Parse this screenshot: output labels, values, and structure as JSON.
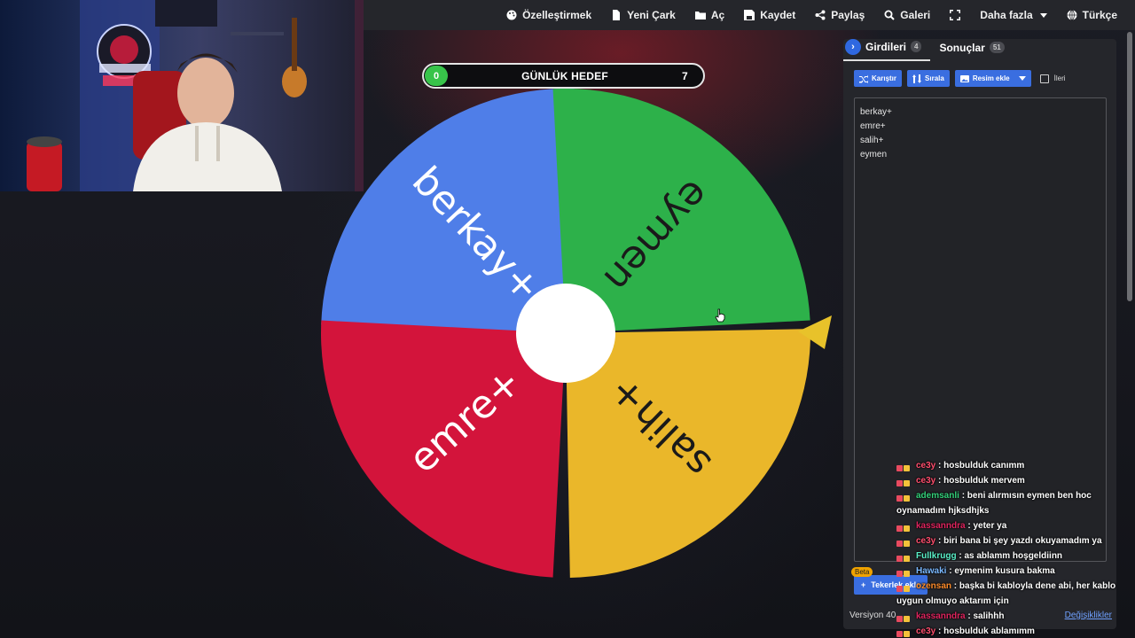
{
  "nav": {
    "items": [
      {
        "label": "Özelleştirmek",
        "icon": "palette-icon"
      },
      {
        "label": "Yeni Çark",
        "icon": "file-icon"
      },
      {
        "label": "Aç",
        "icon": "folder-icon"
      },
      {
        "label": "Kaydet",
        "icon": "save-icon"
      },
      {
        "label": "Paylaş",
        "icon": "share-icon"
      },
      {
        "label": "Galeri",
        "icon": "search-icon"
      },
      {
        "label": "",
        "icon": "fullscreen-icon"
      },
      {
        "label": "Daha fazla",
        "icon": "caret-down-icon"
      },
      {
        "label": "Türkçe",
        "icon": "globe-icon"
      }
    ]
  },
  "goal": {
    "title": "GÜNLÜK HEDEF",
    "current": "0",
    "target": "7",
    "progress": 0
  },
  "wheel": {
    "segments": [
      {
        "label": "berkay+",
        "color": "#4f7ee8"
      },
      {
        "label": "eymen",
        "color": "#2db14a"
      },
      {
        "label": "salih+",
        "color": "#eab72a"
      },
      {
        "label": "emre+",
        "color": "#d3143b"
      }
    ],
    "pointer_color": "#e8c22a"
  },
  "panel": {
    "tab_entries_label": "Girdileri",
    "tab_entries_count": "4",
    "tab_results_label": "Sonuçlar",
    "tab_results_count": "51",
    "shuffle_label": "Karıştır",
    "sort_label": "Sırala",
    "add_image_label": "Resim ekle",
    "advanced_label": "İleri",
    "entries": [
      "berkay+",
      "emre+",
      "salih+",
      "eymen"
    ],
    "beta_label": "Beta",
    "add_wheel_label": "Tekerlek ekle",
    "version_label": "Versiyon 40",
    "changes_label": "Değişiklikler"
  },
  "chat": [
    {
      "user": "ce3y",
      "user_color": "#ff4d6d",
      "message": " : hosbulduk canımm"
    },
    {
      "user": "ce3y",
      "user_color": "#ff4d6d",
      "message": " : hosbulduk mervem"
    },
    {
      "user": "ademsanli",
      "user_color": "#33d17a",
      "message": " : beni alırmısın eymen ben hoc oynamadım hjksdhjks"
    },
    {
      "user": "kassanndra",
      "user_color": "#e0245e",
      "message": " : yeter ya"
    },
    {
      "user": "ce3y",
      "user_color": "#ff4d6d",
      "message": " : biri bana bi şey yazdı okuyamadım ya"
    },
    {
      "user": "Fullkrugg",
      "user_color": "#5af0c8",
      "message": " : as ablamm hoşgeldiinn"
    },
    {
      "user": "Hawaki",
      "user_color": "#7ab8ff",
      "message": " : eymenim kusura bakma"
    },
    {
      "user": "ozensan",
      "user_color": "#ff8c2a",
      "message": " : başka bi kabloyla dene abi, her kablo uygun olmuyo aktarım için"
    },
    {
      "user": "kassanndra",
      "user_color": "#e0245e",
      "message": " : salihhh"
    },
    {
      "user": "ce3y",
      "user_color": "#ff4d6d",
      "message": " : hosbulduk ablamımm"
    }
  ]
}
